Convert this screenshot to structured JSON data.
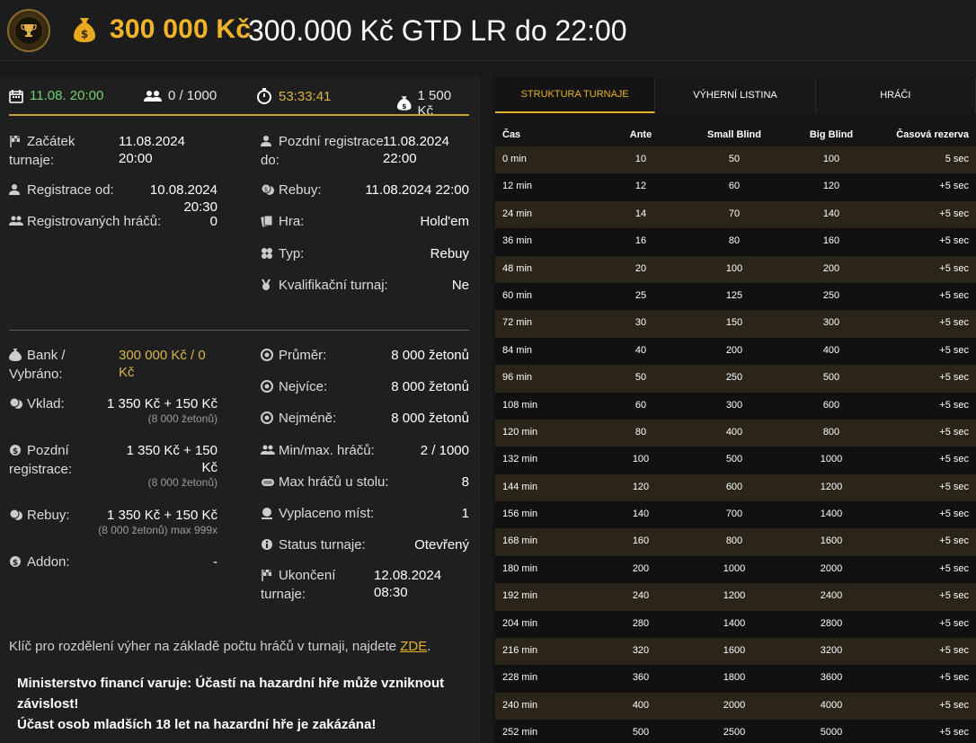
{
  "header": {
    "amount": "300 000 Kč",
    "title": "300.000 Kč GTD LR do 22:00"
  },
  "summary": {
    "start": "11.08. 20:00",
    "players": "0 / 1000",
    "countdown": "53:33:41",
    "buyin": "1 500 Kč"
  },
  "info_left": {
    "start_label": "Začátek turnaje:",
    "start_value": "11.08.2024 20:00",
    "reg_from_label": "Registrace od:",
    "reg_from_value": "10.08.2024 20:30",
    "registered_label": "Registrovaných hráčů:",
    "registered_value": "0"
  },
  "info_right": {
    "late_reg_label": "Pozdní registrace do:",
    "late_reg_value": "11.08.2024 22:00",
    "rebuy_label": "Rebuy:",
    "rebuy_value": "11.08.2024 22:00",
    "game_label": "Hra:",
    "game_value": "Hold'em",
    "type_label": "Typ:",
    "type_value": "Rebuy",
    "qual_label": "Kvalifikační turnaj:",
    "qual_value": "Ne"
  },
  "money_left": {
    "bank_label": "Bank / Vybráno:",
    "bank_value": "300 000 Kč / 0 Kč",
    "deposit_label": "Vklad:",
    "deposit_value": "1 350 Kč + 150 Kč",
    "deposit_sub": "(8 000 žetonů)",
    "late_label": "Pozdní registrace:",
    "late_value": "1 350 Kč + 150 Kč",
    "late_sub": "(8 000 žetonů)",
    "rebuy_label": "Rebuy:",
    "rebuy_value": "1 350 Kč + 150 Kč",
    "rebuy_sub": "(8 000 žetonů) max 999x",
    "addon_label": "Addon:",
    "addon_value": "-"
  },
  "money_right": {
    "avg_label": "Průměr:",
    "avg_value": "8 000 žetonů",
    "most_label": "Nejvíce:",
    "most_value": "8 000 žetonů",
    "least_label": "Nejméně:",
    "least_value": "8 000 žetonů",
    "minmax_label": "Min/max. hráčů:",
    "minmax_value": "2 / 1000",
    "table_label": "Max hráčů u stolu:",
    "table_value": "8",
    "paid_label": "Vyplaceno míst:",
    "paid_value": "1",
    "status_label": "Status turnaje:",
    "status_value": "Otevřený",
    "end_label": "Ukončení turnaje:",
    "end_value": "12.08.2024 08:30"
  },
  "note": {
    "text": "Klíč pro rozdělení výher na základě počtu hráčů v turnaji, najdete",
    "link": "ZDE",
    "tail": "."
  },
  "warning": {
    "line1": "Ministerstvo financí varuje: Účastí na hazardní hře může vzniknout závislost!",
    "line2": "Účast osob mladších 18 let na hazardní hře je zakázána!"
  },
  "tabs": [
    "STRUKTURA TURNAJE",
    "VÝHERNÍ LISTINA",
    "HRÁČI"
  ],
  "table": {
    "headers": [
      "Čas",
      "Ante",
      "Small Blind",
      "Big Blind",
      "Časová rezerva"
    ],
    "rows": [
      [
        "0 min",
        "10",
        "50",
        "100",
        "5 sec"
      ],
      [
        "12 min",
        "12",
        "60",
        "120",
        "+5 sec"
      ],
      [
        "24 min",
        "14",
        "70",
        "140",
        "+5 sec"
      ],
      [
        "36 min",
        "16",
        "80",
        "160",
        "+5 sec"
      ],
      [
        "48 min",
        "20",
        "100",
        "200",
        "+5 sec"
      ],
      [
        "60 min",
        "25",
        "125",
        "250",
        "+5 sec"
      ],
      [
        "72 min",
        "30",
        "150",
        "300",
        "+5 sec"
      ],
      [
        "84 min",
        "40",
        "200",
        "400",
        "+5 sec"
      ],
      [
        "96 min",
        "50",
        "250",
        "500",
        "+5 sec"
      ],
      [
        "108 min",
        "60",
        "300",
        "600",
        "+5 sec"
      ],
      [
        "120 min",
        "80",
        "400",
        "800",
        "+5 sec"
      ],
      [
        "132 min",
        "100",
        "500",
        "1000",
        "+5 sec"
      ],
      [
        "144 min",
        "120",
        "600",
        "1200",
        "+5 sec"
      ],
      [
        "156 min",
        "140",
        "700",
        "1400",
        "+5 sec"
      ],
      [
        "168 min",
        "160",
        "800",
        "1600",
        "+5 sec"
      ],
      [
        "180 min",
        "200",
        "1000",
        "2000",
        "+5 sec"
      ],
      [
        "192 min",
        "240",
        "1200",
        "2400",
        "+5 sec"
      ],
      [
        "204 min",
        "280",
        "1400",
        "2800",
        "+5 sec"
      ],
      [
        "216 min",
        "320",
        "1600",
        "3200",
        "+5 sec"
      ],
      [
        "228 min",
        "360",
        "1800",
        "3600",
        "+5 sec"
      ],
      [
        "240 min",
        "400",
        "2000",
        "4000",
        "+5 sec"
      ],
      [
        "252 min",
        "500",
        "2500",
        "5000",
        "+5 sec"
      ]
    ]
  },
  "colors": {
    "gold": "#f0b429",
    "green": "#6fd36f",
    "accent": "#e8b227"
  }
}
